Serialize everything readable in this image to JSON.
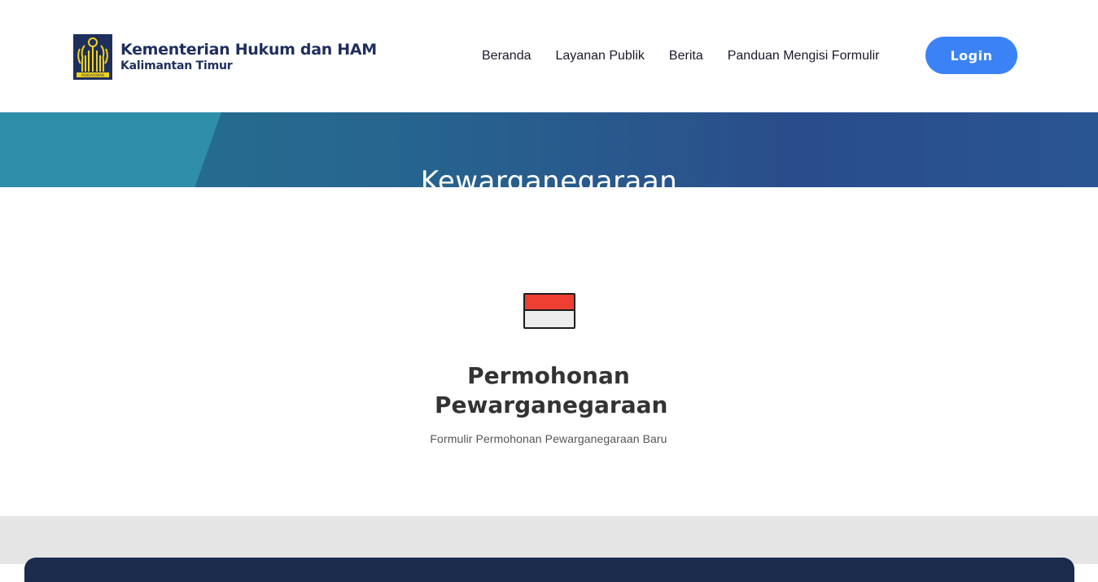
{
  "header": {
    "logo": {
      "title": "Kementerian Hukum dan HAM",
      "subtitle": "Kalimantan Timur",
      "emblem_text": "PENGAYOMAN"
    },
    "nav": [
      {
        "label": "Beranda"
      },
      {
        "label": "Layanan Publik"
      },
      {
        "label": "Berita"
      },
      {
        "label": "Panduan Mengisi Formulir"
      }
    ],
    "login_label": "Login"
  },
  "banner": {
    "title": "Kewarganegaraan"
  },
  "service": {
    "icon": "indonesia-flag-icon",
    "title": "Permohonan Pewarganegaraan",
    "description": "Formulir Permohonan Pewarganegaraan Baru"
  },
  "colors": {
    "brand_navy": "#1f2f5c",
    "login_blue": "#3b82f6",
    "banner_teal": "#2f8ea9",
    "banner_blue": "#2a4f8b",
    "flag_red": "#ef3f32",
    "footer_navy": "#1a2b4c"
  }
}
